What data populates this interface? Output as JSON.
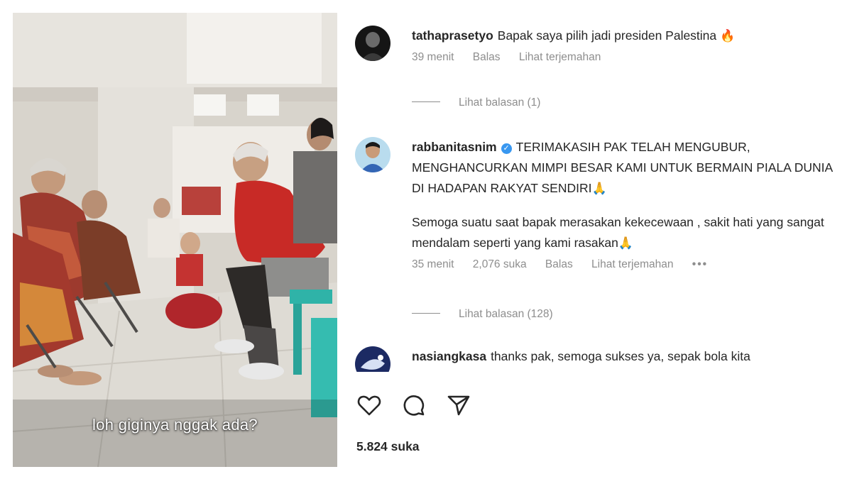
{
  "video": {
    "caption": "loh giginya nggak ada?"
  },
  "comments": [
    {
      "username": "tathaprasetyo",
      "paragraphs": [
        "Bapak saya pilih jadi presiden Palestina"
      ],
      "emoji": "🔥",
      "time": "39 menit",
      "reply_label": "Balas",
      "translate_label": "Lihat terjemahan",
      "view_replies": "Lihat balasan (1)"
    },
    {
      "username": "rabbanitasnim",
      "verified": true,
      "paragraphs": [
        "TERIMAKASIH PAK TELAH MENGUBUR, MENGHANCURKAN MIMPI BESAR KAMI UNTUK BERMAIN PIALA DUNIA DI HADAPAN RAKYAT SENDIRI",
        "Semoga suatu saat bapak merasakan kekecewaan , sakit hati yang sangat mendalam seperti yang kami rasakan"
      ],
      "emoji_1": "🙏",
      "emoji_2": "🙏",
      "time": "35 menit",
      "likes": "2,076 suka",
      "reply_label": "Balas",
      "translate_label": "Lihat terjemahan",
      "more_label": "•••",
      "view_replies": "Lihat balasan (128)"
    },
    {
      "username": "nasiangkasa",
      "paragraphs": [
        "thanks pak, semoga sukses ya, sepak bola kita"
      ]
    }
  ],
  "actions": {
    "icons": [
      "heart-icon",
      "comment-icon",
      "share-icon"
    ]
  },
  "post": {
    "likes": "5.824 suka"
  }
}
